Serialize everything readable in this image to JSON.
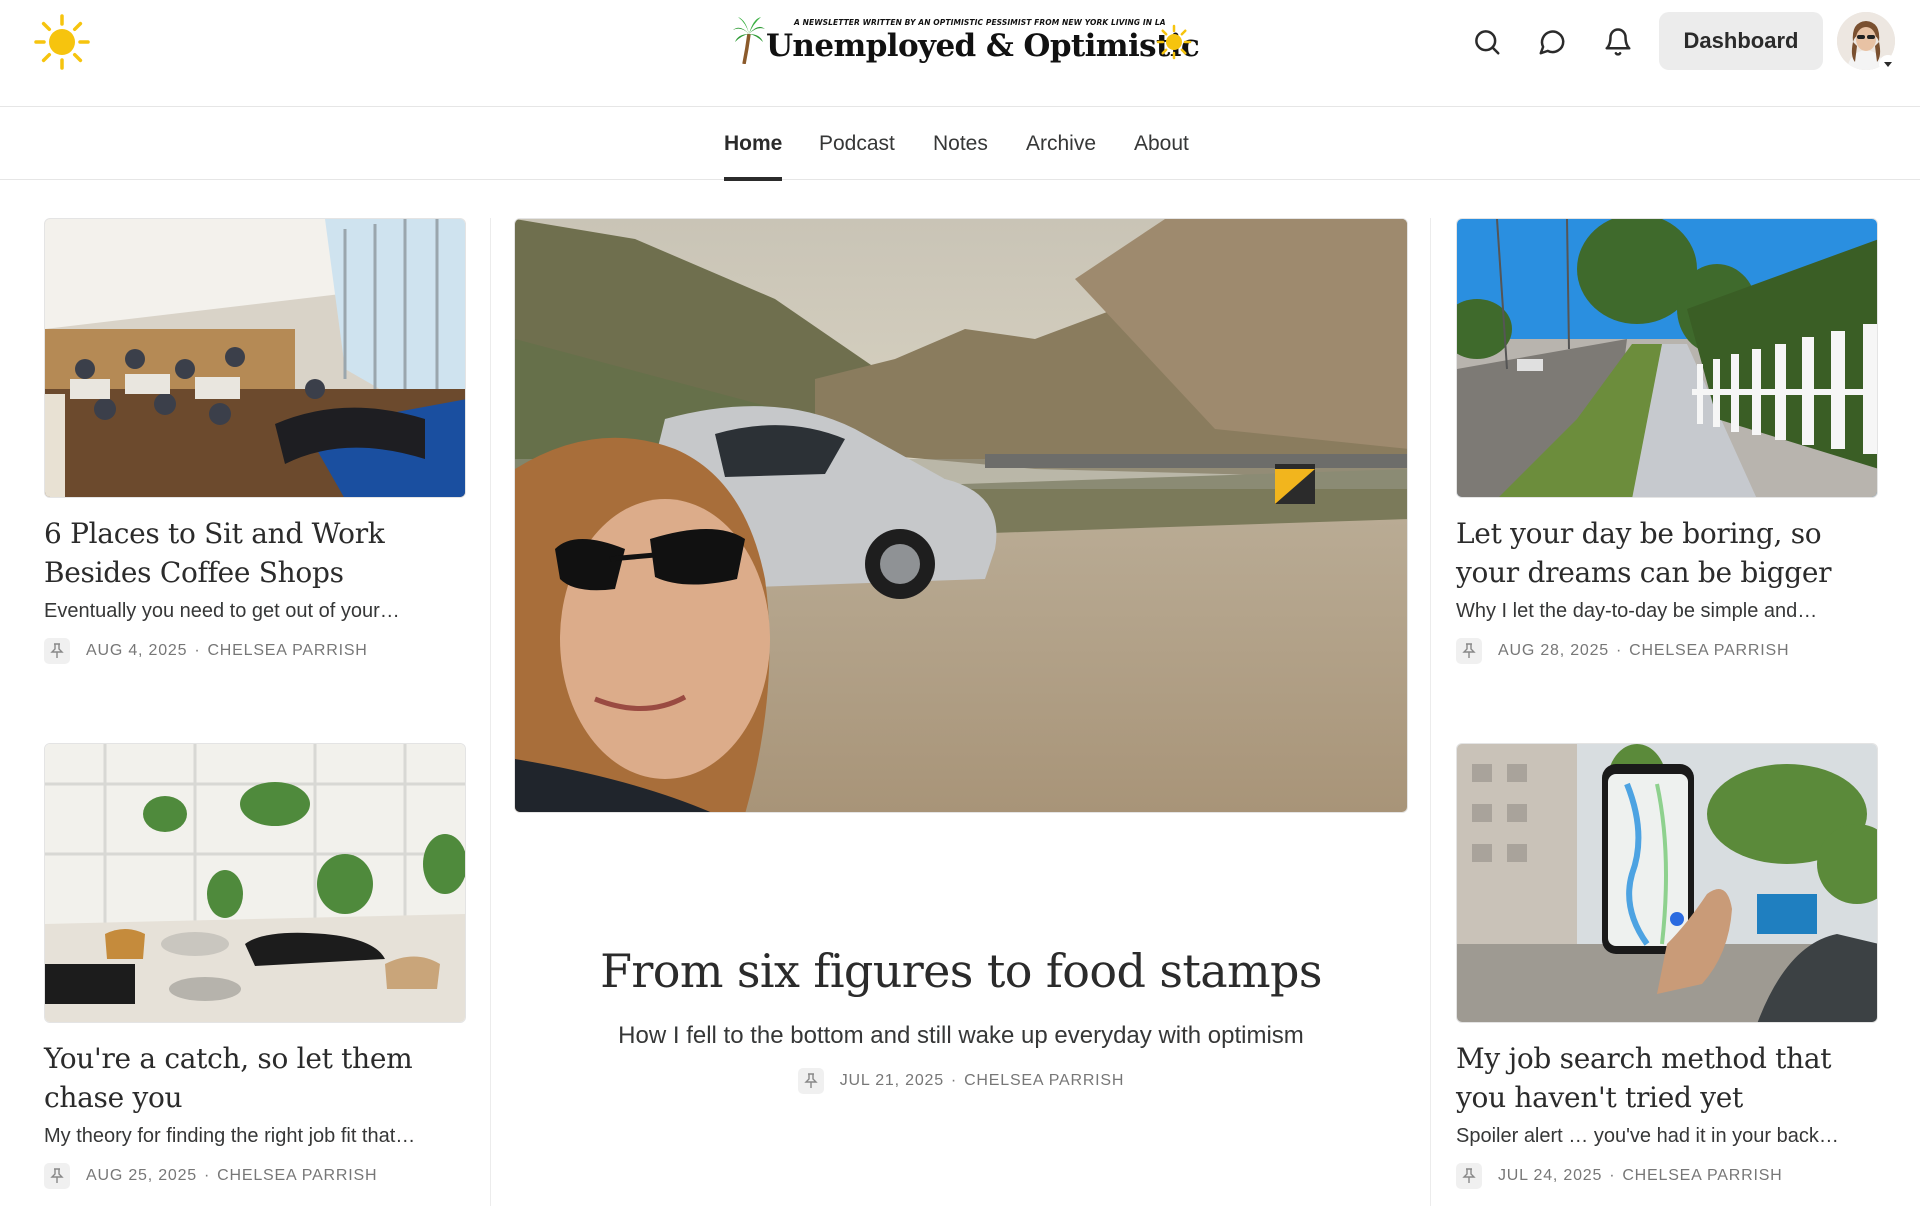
{
  "header": {
    "tagline": "A NEWSLETTER WRITTEN BY AN OPTIMISTIC PESSIMIST FROM NEW YORK LIVING IN LA",
    "wordmark": "Unemployed & Optimistic",
    "dashboard_label": "Dashboard",
    "icons": [
      "sun-icon",
      "palm-tree-icon",
      "search-icon",
      "chat-bubble-icon",
      "bell-icon",
      "chevron-down-icon"
    ]
  },
  "nav": {
    "items": [
      {
        "label": "Home",
        "active": true
      },
      {
        "label": "Podcast",
        "active": false
      },
      {
        "label": "Notes",
        "active": false
      },
      {
        "label": "Archive",
        "active": false
      },
      {
        "label": "About",
        "active": false
      }
    ]
  },
  "featured": {
    "title": "From six figures to food stamps",
    "subtitle": "How I fell to the bottom and still wake up everyday with optimism",
    "date": "JUL 21, 2025",
    "author": "CHELSEA PARRISH"
  },
  "posts": [
    {
      "title": "6 Places to Sit and Work Besides Coffee Shops",
      "subtitle": "Eventually you need to get out of your…",
      "date": "AUG 4, 2025",
      "author": "CHELSEA PARRISH"
    },
    {
      "title": "You're a catch, so let them chase you",
      "subtitle": "My theory for finding the right job fit that…",
      "date": "AUG 25, 2025",
      "author": "CHELSEA PARRISH"
    },
    {
      "title": "Let your day be boring, so your dreams can be bigger",
      "subtitle": "Why I let the day-to-day be simple and…",
      "date": "AUG 28, 2025",
      "author": "CHELSEA PARRISH"
    },
    {
      "title": "My job search method that you haven't tried yet",
      "subtitle": "Spoiler alert … you've had it in your back…",
      "date": "JUL 24, 2025",
      "author": "CHELSEA PARRISH"
    }
  ],
  "colors": {
    "accent": "#2b2b2b",
    "sun": "#f6c40e",
    "meta_text": "#777777",
    "button_bg": "#ececec"
  }
}
